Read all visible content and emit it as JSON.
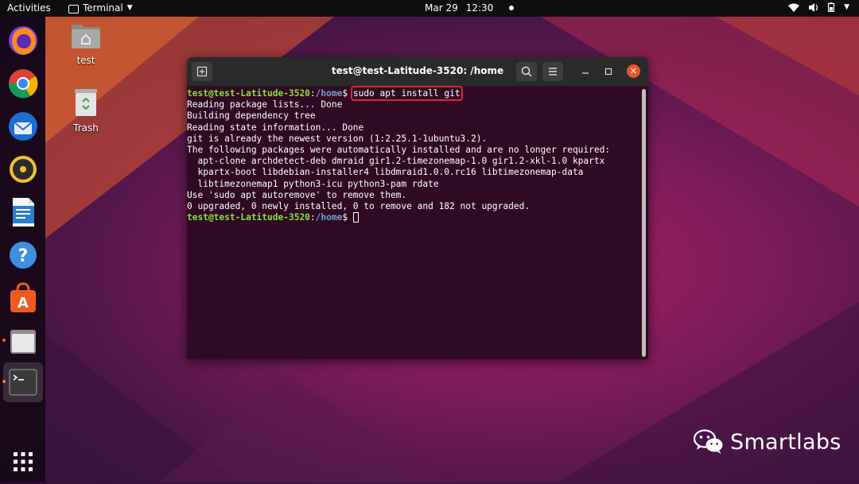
{
  "topbar": {
    "activities": "Activities",
    "app_name": "Terminal",
    "date": "Mar 29",
    "time": "12:30"
  },
  "dock": {
    "items": [
      {
        "name": "firefox",
        "icon": "firefox-icon"
      },
      {
        "name": "chrome",
        "icon": "chrome-icon"
      },
      {
        "name": "thunderbird",
        "icon": "thunderbird-icon"
      },
      {
        "name": "rhythmbox",
        "icon": "rhythmbox-icon"
      },
      {
        "name": "writer",
        "icon": "libreoffice-writer-icon"
      },
      {
        "name": "help",
        "icon": "help-icon"
      },
      {
        "name": "software",
        "icon": "software-center-icon"
      },
      {
        "name": "files",
        "icon": "files-icon"
      },
      {
        "name": "terminal",
        "icon": "terminal-icon"
      },
      {
        "name": "app-grid",
        "icon": "show-applications-icon"
      }
    ]
  },
  "desktop": {
    "home_label": "test",
    "trash_label": "Trash"
  },
  "terminal": {
    "title": "test@test-Latitude-3520: /home",
    "prompt_user": "test@test-Latitude-3520",
    "prompt_sep": ":",
    "prompt_path": "/home",
    "prompt_end": "$ ",
    "command": "sudo apt install git",
    "output": [
      "Reading package lists... Done",
      "Building dependency tree",
      "Reading state information... Done",
      "git is already the newest version (1:2.25.1-1ubuntu3.2).",
      "The following packages were automatically installed and are no longer required:",
      "  apt-clone archdetect-deb dmraid gir1.2-timezonemap-1.0 gir1.2-xkl-1.0 kpartx",
      "  kpartx-boot libdebian-installer4 libdmraid1.0.0.rc16 libtimezonemap-data",
      "  libtimezonemap1 python3-icu python3-pam rdate",
      "Use 'sudo apt autoremove' to remove them.",
      "0 upgraded, 0 newly installed, 0 to remove and 182 not upgraded."
    ]
  },
  "watermark": {
    "text": "Smartlabs",
    "icon": "wechat-icon"
  }
}
